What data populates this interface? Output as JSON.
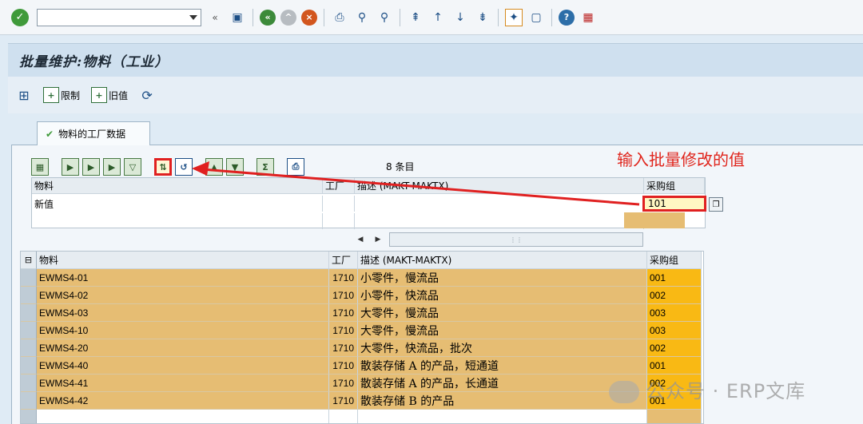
{
  "system_toolbar": {
    "command_field_value": ""
  },
  "title": "批量维护:物料（工业）",
  "app_toolbar": {
    "restrict_label": "限制",
    "old_value_label": "旧值"
  },
  "tab": {
    "label": "物料的工厂数据"
  },
  "grid_toolbar": {
    "count_text": "8 条目"
  },
  "annotation_text": "输入批量修改的值",
  "upper_grid": {
    "headers": {
      "material": "物料",
      "plant": "工厂",
      "description": "描述 (MAKT-MAKTX)",
      "purchasing_group": "采购组"
    },
    "new_value_label": "新值",
    "new_value_input": "101"
  },
  "lower_grid": {
    "headers": {
      "material": "物料",
      "plant": "工厂",
      "description": "描述 (MAKT-MAKTX)",
      "purchasing_group": "采购组"
    },
    "rows": [
      {
        "material": "EWMS4-01",
        "plant": "1710",
        "description": "小零件，慢流品",
        "group": "001"
      },
      {
        "material": "EWMS4-02",
        "plant": "1710",
        "description": "小零件，快流品",
        "group": "002"
      },
      {
        "material": "EWMS4-03",
        "plant": "1710",
        "description": "大零件，慢流品",
        "group": "003"
      },
      {
        "material": "EWMS4-10",
        "plant": "1710",
        "description": "大零件，慢流品",
        "group": "003"
      },
      {
        "material": "EWMS4-20",
        "plant": "1710",
        "description": "大零件，快流品，批次",
        "group": "002"
      },
      {
        "material": "EWMS4-40",
        "plant": "1710",
        "description": "散装存储 A 的产品，短通道",
        "group": "001"
      },
      {
        "material": "EWMS4-41",
        "plant": "1710",
        "description": "散装存储 A 的产品，长通道",
        "group": "002"
      },
      {
        "material": "EWMS4-42",
        "plant": "1710",
        "description": "散装存储 B 的产品",
        "group": "001"
      }
    ]
  },
  "watermark": "公众号 · ERP文库"
}
